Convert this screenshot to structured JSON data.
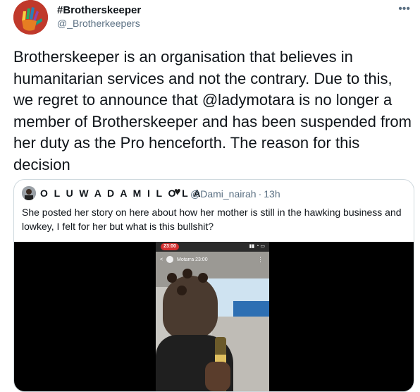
{
  "tweet": {
    "display_name": "#Brotherskeeper",
    "handle": "@_Brotherkeepers",
    "more_label": "•••",
    "text": "Brotherskeeper is an organisation that believes in humanitarian services and not the contrary. Due to this, we regret to announce that @ladymotara is no longer a member of Brotherskeeper and has been suspended from her duty as the Pro henceforth. The reason for this decision"
  },
  "quoted_tweet": {
    "display_name": "O L U W A D A M I L O L A",
    "heart": "♥",
    "handle": "@Dami_nairah",
    "separator": "·",
    "time": "13h",
    "text": "She posted her story on here about how her mother is still in the hawking business and lowkey, I felt for her but what is this bullshit?",
    "media": {
      "status_time": "23:00",
      "story_user": "Motarra",
      "story_time": "23:00"
    }
  },
  "colors": {
    "text_primary": "#0f1419",
    "text_secondary": "#5b7083",
    "border": "#cfd9de",
    "avatar_bg": "#c0392b"
  }
}
